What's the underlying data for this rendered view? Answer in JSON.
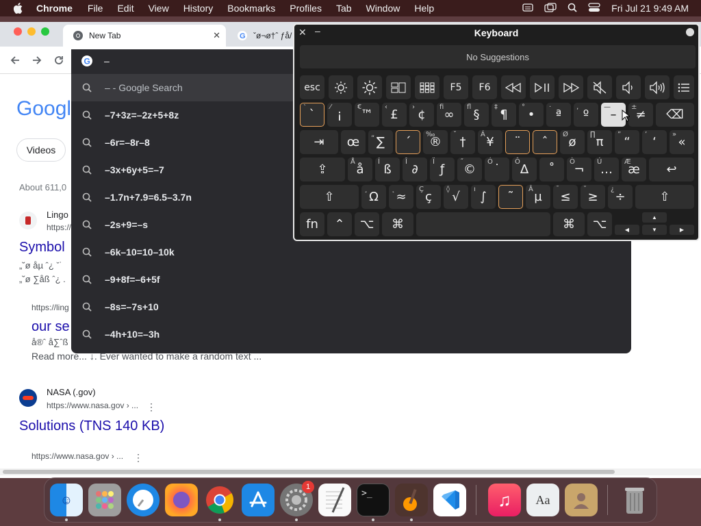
{
  "menubar": {
    "app_name": "Chrome",
    "items": [
      "File",
      "Edit",
      "View",
      "History",
      "Bookmarks",
      "Profiles",
      "Tab",
      "Window",
      "Help"
    ],
    "clock": "Fri Jul 21  9:49 AM"
  },
  "browser": {
    "tabs": [
      {
        "title": "New Tab",
        "close": "✕"
      },
      {
        "title": "ˇø¬ø†ˆ ƒå/"
      }
    ],
    "omnibox_text": "–",
    "suggestions": [
      "– - Google Search",
      "–7+3z=–2z+5+8z",
      "–6r=–8r–8",
      "–3x+6y+5=–7",
      "–1.7n+7.9=6.5–3.7n",
      "–2s+9=–s",
      "–6k–10=10–10k",
      "–9+8f=–6+5f",
      "–8s=–7s+10",
      "–4h+10=–3h"
    ]
  },
  "page": {
    "logo_text": "Googl",
    "chip": "Videos",
    "about": "About 611,0",
    "results": [
      {
        "site": "Lingo",
        "url": "https://",
        "title": "Symbol",
        "snippet1": "„˘ø åµ ˆ¿ ˇ˙",
        "snippet2": "„˘ø ∑åß ˆ¿ ."
      },
      {
        "url": "https://ling",
        "title": "our se",
        "snippet1": "å®ˆ å∑ˆß",
        "snippet2": "Read more... ↓. Ever wanted to make a random text ..."
      },
      {
        "site": "NASA (.gov)",
        "url": "https://www.nasa.gov › ...",
        "title": "Solutions (TNS 140 KB)"
      },
      {
        "url": "https://www.nasa.gov › ..."
      }
    ]
  },
  "keyboard": {
    "title": "Keyboard",
    "suggestions_text": "No Suggestions",
    "keys": {
      "esc": "esc",
      "f5": "F5",
      "f6": "F6",
      "r2": [
        "`",
        "¡",
        "™",
        "£",
        "¢",
        "∞",
        "§",
        "¶",
        "•",
        "ª",
        "º",
        "–",
        "≠",
        "⌫"
      ],
      "r2_small": [
        "`",
        "⁄",
        "€",
        "‹",
        "›",
        "ﬁ",
        "ﬂ",
        "‡",
        "°",
        "·",
        "‚",
        "—",
        "±",
        ""
      ],
      "r3": [
        "⇥",
        "œ",
        "∑",
        "´",
        "®",
        "†",
        "¥",
        "¨",
        "ˆ",
        "ø",
        "π",
        "“",
        "‘",
        "«"
      ],
      "r3_small": [
        "",
        "",
        "„",
        "",
        "‰",
        "ˇ",
        "Á",
        "",
        "",
        "Ø",
        "∏",
        "”",
        "’",
        "»"
      ],
      "r4": [
        "⇪",
        "å",
        "ß",
        "∂",
        "ƒ",
        "©",
        "˙",
        "∆",
        "˚",
        "¬",
        "…",
        "æ",
        "↩"
      ],
      "r4_small": [
        "",
        "Å",
        "Í",
        "Î",
        "Ï",
        "˝",
        "Ó",
        "Ô",
        "",
        "Ò",
        "Ú",
        "Æ",
        ""
      ],
      "r5": [
        "⇧",
        "Ω",
        "≈",
        "ç",
        "√",
        "∫",
        "˜",
        "µ",
        "≤",
        "≥",
        "÷",
        "⇧"
      ],
      "r5_small": [
        "",
        "¸",
        "˛",
        "Ç",
        "◊",
        "ı",
        "",
        "Â",
        "¯",
        "˘",
        "¿",
        ""
      ],
      "r6": [
        "fn",
        "⌃",
        "⌥",
        "⌘",
        "⌘",
        "⌥"
      ]
    }
  },
  "dock": {
    "apps": [
      "Finder",
      "Launchpad",
      "Safari",
      "Firefox",
      "Chrome",
      "App Store",
      "System Settings",
      "TextEdit",
      "Terminal",
      "GarageBand",
      "VS Code",
      "Music",
      "Dictionary",
      "Contacts",
      "Trash"
    ],
    "system_settings_badge": "1"
  }
}
